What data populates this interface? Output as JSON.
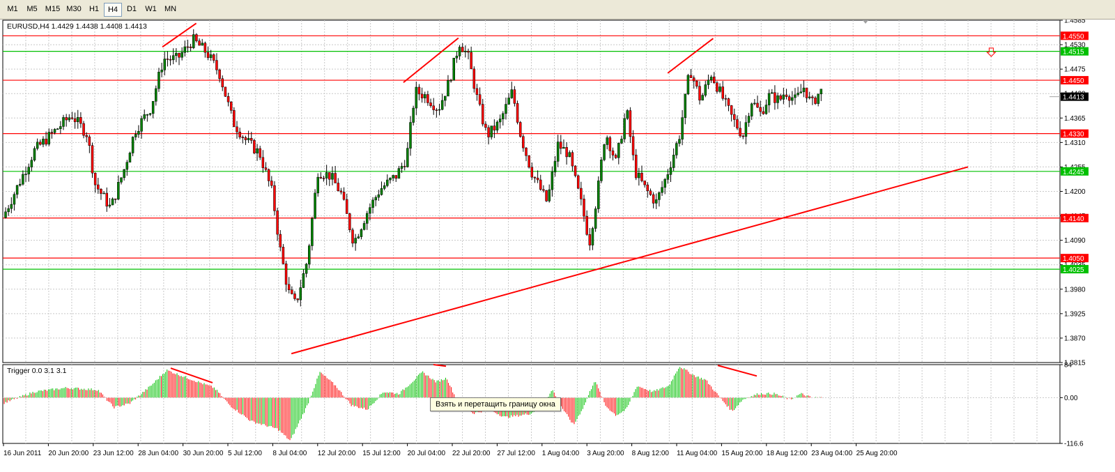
{
  "toolbar": {
    "timeframes": [
      "M1",
      "M5",
      "M15",
      "M30",
      "H1",
      "H4",
      "D1",
      "W1",
      "MN"
    ],
    "active": "H4"
  },
  "tooltip": "Взять и перетащить границу окна",
  "chart_data": [
    {
      "type": "candlestick",
      "title": "EURUSD,H4  1.4429 1.4438 1.4408 1.4413",
      "ylim": [
        1.3815,
        1.4585
      ],
      "y_ticks": [
        "1.4585",
        "1.4530",
        "1.4475",
        "1.4420",
        "1.4365",
        "1.4310",
        "1.4255",
        "1.4200",
        "1.4145",
        "1.4090",
        "1.4035",
        "1.3980",
        "1.3925",
        "1.3870",
        "1.3815"
      ],
      "x_ticks": [
        "16 Jun 2011",
        "20 Jun 20:00",
        "23 Jun 12:00",
        "28 Jun 04:00",
        "30 Jun 20:00",
        "5 Jul 12:00",
        "8 Jul 04:00",
        "12 Jul 20:00",
        "15 Jul 12:00",
        "20 Jul 04:00",
        "22 Jul 20:00",
        "27 Jul 12:00",
        "1 Aug 04:00",
        "3 Aug 20:00",
        "8 Aug 12:00",
        "11 Aug 04:00",
        "15 Aug 20:00",
        "18 Aug 12:00",
        "23 Aug 04:00",
        "25 Aug 20:00"
      ],
      "price_lines": [
        {
          "value": 1.455,
          "label": "1.4550",
          "color": "#ff0000"
        },
        {
          "value": 1.4515,
          "label": "1.4515",
          "color": "#00c000"
        },
        {
          "value": 1.445,
          "label": "1.4450",
          "color": "#ff0000"
        },
        {
          "value": 1.433,
          "label": "1.4330",
          "color": "#ff0000"
        },
        {
          "value": 1.4245,
          "label": "1.4245",
          "color": "#00c000"
        },
        {
          "value": 1.414,
          "label": "1.4140",
          "color": "#ff0000"
        },
        {
          "value": 1.405,
          "label": "1.4050",
          "color": "#ff0000"
        },
        {
          "value": 1.4025,
          "label": "1.4025",
          "color": "#00c000"
        }
      ],
      "current_price": {
        "value": 1.4413,
        "label": "1.4413"
      },
      "trend_lines": [
        {
          "x": [
            0.273,
            0.913
          ],
          "y": [
            1.3835,
            1.4255
          ]
        },
        {
          "x": [
            0.151,
            0.183
          ],
          "y": [
            1.4525,
            1.4578
          ]
        },
        {
          "x": [
            0.379,
            0.431
          ],
          "y": [
            1.4445,
            1.4545
          ]
        },
        {
          "x": [
            0.629,
            0.672
          ],
          "y": [
            1.4466,
            1.4544
          ]
        }
      ],
      "arrow_x": 0.935,
      "arrow_y": 1.4513,
      "candles_series": [
        {
          "name": "segment",
          "points": [
            [
              0.0,
              1.4141
            ],
            [
              0.03,
              1.4292
            ],
            [
              0.065,
              1.4372
            ],
            [
              0.08,
              1.4328
            ],
            [
              0.087,
              1.4218
            ],
            [
              0.102,
              1.4162
            ],
            [
              0.115,
              1.4251
            ],
            [
              0.125,
              1.4336
            ],
            [
              0.14,
              1.4388
            ],
            [
              0.152,
              1.4498
            ],
            [
              0.165,
              1.4498
            ],
            [
              0.18,
              1.4541
            ],
            [
              0.193,
              1.4512
            ],
            [
              0.205,
              1.4465
            ],
            [
              0.218,
              1.4355
            ],
            [
              0.23,
              1.4315
            ],
            [
              0.243,
              1.4285
            ],
            [
              0.255,
              1.4196
            ],
            [
              0.262,
              1.4075
            ],
            [
              0.27,
              1.3975
            ],
            [
              0.277,
              1.3945
            ],
            [
              0.288,
              1.4045
            ],
            [
              0.298,
              1.4245
            ],
            [
              0.31,
              1.4235
            ],
            [
              0.32,
              1.4195
            ],
            [
              0.332,
              1.4085
            ],
            [
              0.345,
              1.4155
            ],
            [
              0.357,
              1.4205
            ],
            [
              0.372,
              1.4235
            ],
            [
              0.382,
              1.4275
            ],
            [
              0.39,
              1.4425
            ],
            [
              0.4,
              1.4415
            ],
            [
              0.412,
              1.4385
            ],
            [
              0.422,
              1.4445
            ],
            [
              0.432,
              1.4535
            ],
            [
              0.44,
              1.4505
            ],
            [
              0.45,
              1.4395
            ],
            [
              0.458,
              1.4325
            ],
            [
              0.47,
              1.4355
            ],
            [
              0.482,
              1.4425
            ],
            [
              0.49,
              1.4325
            ],
            [
              0.5,
              1.4245
            ],
            [
              0.515,
              1.4175
            ],
            [
              0.525,
              1.4305
            ],
            [
              0.535,
              1.4285
            ],
            [
              0.548,
              1.4165
            ],
            [
              0.555,
              1.4085
            ],
            [
              0.563,
              1.4205
            ],
            [
              0.57,
              1.4335
            ],
            [
              0.58,
              1.4265
            ],
            [
              0.59,
              1.4385
            ],
            [
              0.598,
              1.4245
            ],
            [
              0.608,
              1.4205
            ],
            [
              0.618,
              1.4175
            ],
            [
              0.628,
              1.4235
            ],
            [
              0.64,
              1.4325
            ],
            [
              0.65,
              1.4475
            ],
            [
              0.66,
              1.4405
            ],
            [
              0.67,
              1.4465
            ],
            [
              0.68,
              1.4415
            ],
            [
              0.69,
              1.4365
            ],
            [
              0.7,
              1.4325
            ],
            [
              0.708,
              1.4405
            ],
            [
              0.717,
              1.4375
            ],
            [
              0.725,
              1.4415
            ],
            [
              0.735,
              1.4405
            ],
            [
              0.74,
              1.4425
            ],
            [
              0.75,
              1.4405
            ],
            [
              0.758,
              1.4435
            ],
            [
              0.765,
              1.4395
            ],
            [
              0.773,
              1.4425
            ]
          ]
        }
      ]
    },
    {
      "type": "bar",
      "title": "Trigger 0.0 3.1 3.1",
      "ylim": [
        -116.6,
        84
      ],
      "y_ticks": [
        "84",
        "0.00",
        "-116.6"
      ],
      "series_profile": [
        [
          0.0,
          -15
        ],
        [
          0.03,
          15
        ],
        [
          0.06,
          25
        ],
        [
          0.09,
          20
        ],
        [
          0.105,
          -25
        ],
        [
          0.12,
          -15
        ],
        [
          0.14,
          30
        ],
        [
          0.155,
          70
        ],
        [
          0.17,
          55
        ],
        [
          0.2,
          25
        ],
        [
          0.215,
          -20
        ],
        [
          0.235,
          -60
        ],
        [
          0.26,
          -80
        ],
        [
          0.272,
          -110
        ],
        [
          0.288,
          -20
        ],
        [
          0.3,
          65
        ],
        [
          0.315,
          30
        ],
        [
          0.33,
          -20
        ],
        [
          0.345,
          -30
        ],
        [
          0.36,
          15
        ],
        [
          0.375,
          10
        ],
        [
          0.385,
          35
        ],
        [
          0.397,
          65
        ],
        [
          0.41,
          40
        ],
        [
          0.42,
          50
        ],
        [
          0.43,
          -10
        ],
        [
          0.445,
          -40
        ],
        [
          0.46,
          -30
        ],
        [
          0.475,
          -50
        ],
        [
          0.49,
          -45
        ],
        [
          0.5,
          -40
        ],
        [
          0.51,
          -20
        ],
        [
          0.52,
          20
        ],
        [
          0.53,
          -30
        ],
        [
          0.54,
          -70
        ],
        [
          0.55,
          -20
        ],
        [
          0.56,
          45
        ],
        [
          0.57,
          -20
        ],
        [
          0.58,
          -45
        ],
        [
          0.59,
          -30
        ],
        [
          0.6,
          30
        ],
        [
          0.615,
          15
        ],
        [
          0.63,
          30
        ],
        [
          0.64,
          80
        ],
        [
          0.655,
          55
        ],
        [
          0.665,
          45
        ],
        [
          0.68,
          -5
        ],
        [
          0.69,
          -35
        ],
        [
          0.7,
          -5
        ],
        [
          0.715,
          10
        ],
        [
          0.73,
          10
        ],
        [
          0.745,
          -5
        ],
        [
          0.755,
          10
        ],
        [
          0.765,
          0
        ],
        [
          0.775,
          0
        ]
      ]
    }
  ]
}
